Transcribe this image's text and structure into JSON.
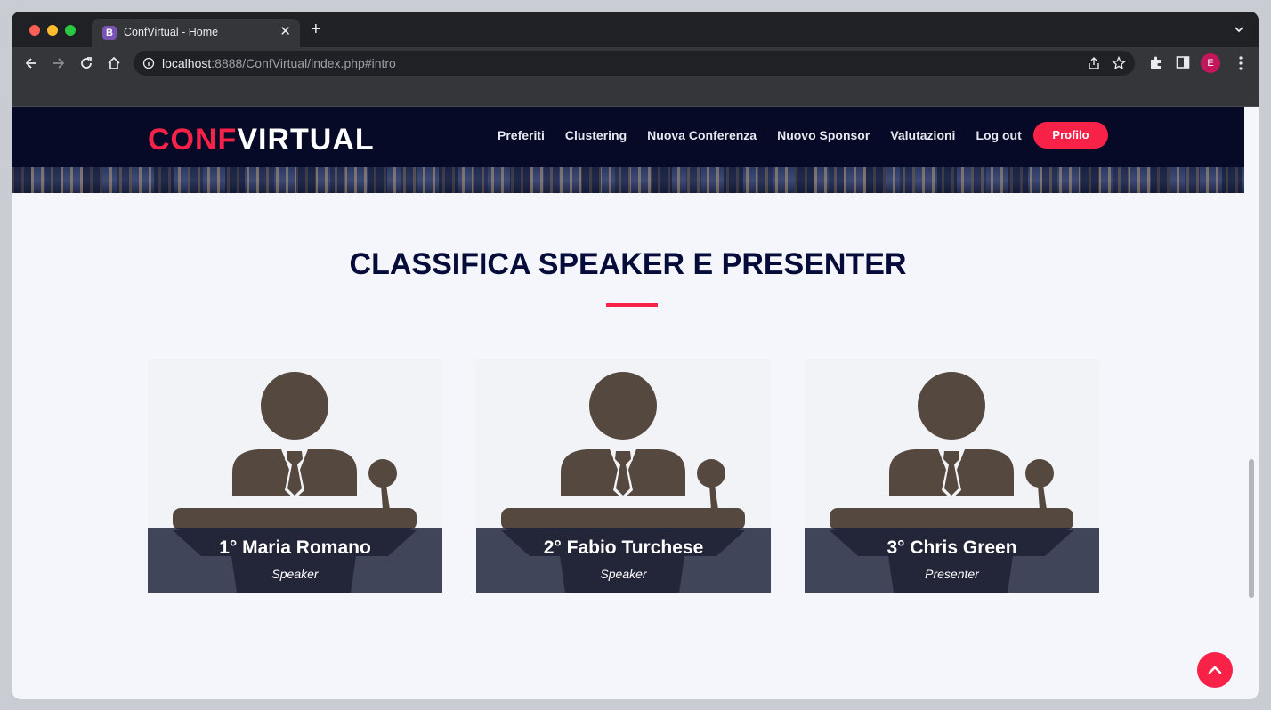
{
  "browser": {
    "tab_favicon": "B",
    "tab_title": "ConfVirtual - Home",
    "url_host": "localhost",
    "url_rest": ":8888/ConfVirtual/index.php#intro",
    "profile_initial": "E"
  },
  "site": {
    "logo_part1": "CONF",
    "logo_part2": "VIRTUAL",
    "nav": [
      "Preferiti",
      "Clustering",
      "Nuova Conferenza",
      "Nuovo Sponsor",
      "Valutazioni",
      "Log out"
    ],
    "profile_button": "Profilo"
  },
  "section": {
    "title": "CLASSIFICA SPEAKER E PRESENTER"
  },
  "ranking": [
    {
      "name": "1° Maria Romano",
      "role": "Speaker"
    },
    {
      "name": "2° Fabio Turchese",
      "role": "Speaker"
    },
    {
      "name": "3° Chris Green",
      "role": "Presenter"
    }
  ],
  "colors": {
    "accent": "#f82249",
    "nav_bg": "#060a26",
    "title": "#060c3a",
    "speaker_art": "#55483e"
  }
}
